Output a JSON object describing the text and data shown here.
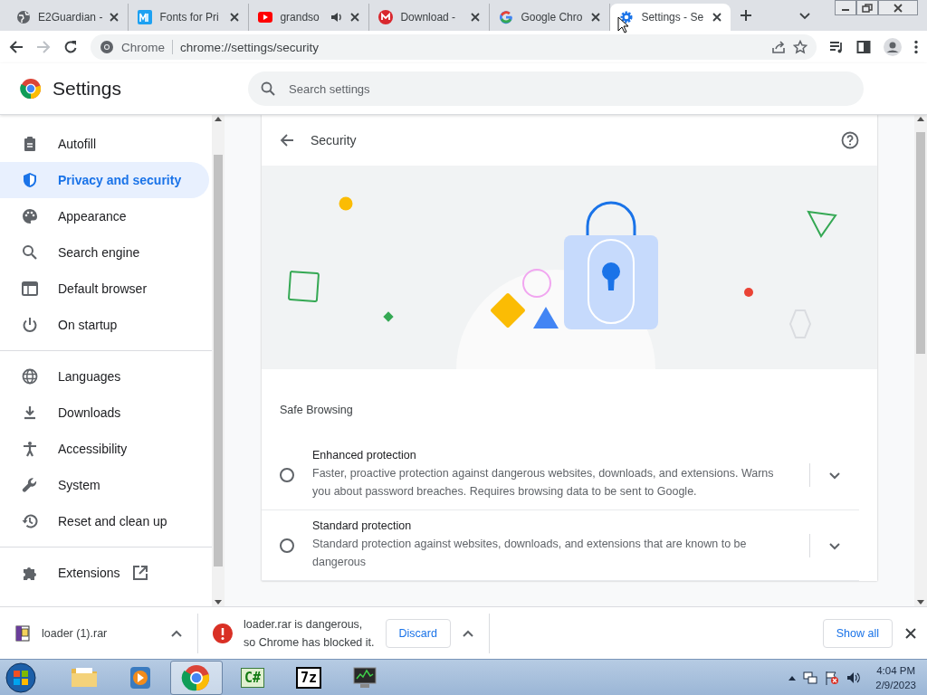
{
  "tabs": [
    {
      "title": "E2Guardian -",
      "kind": "globe",
      "audio": false,
      "selected": false
    },
    {
      "title": "Fonts for Pri",
      "kind": "fonts",
      "audio": false,
      "selected": false
    },
    {
      "title": "grandso",
      "kind": "video",
      "audio": true,
      "selected": false
    },
    {
      "title": "Download - ",
      "kind": "mega",
      "audio": false,
      "selected": false
    },
    {
      "title": "Google Chro",
      "kind": "google",
      "audio": false,
      "selected": false
    },
    {
      "title": "Settings - Se",
      "kind": "gear",
      "audio": false,
      "selected": true
    }
  ],
  "address_bar": {
    "site": "Chrome",
    "url": "chrome://settings/security"
  },
  "header": {
    "title": "Settings",
    "search_placeholder": "Search settings"
  },
  "sidebar": {
    "items": [
      {
        "label": "Autofill",
        "kind": "clipboard",
        "selected": false
      },
      {
        "label": "Privacy and security",
        "kind": "shield",
        "selected": true
      },
      {
        "label": "Appearance",
        "kind": "palette",
        "selected": false
      },
      {
        "label": "Search engine",
        "kind": "search",
        "selected": false
      },
      {
        "label": "Default browser",
        "kind": "browser",
        "selected": false
      },
      {
        "label": "On startup",
        "kind": "power",
        "selected": false
      },
      {
        "label": "Languages",
        "kind": "globe",
        "selected": false
      },
      {
        "label": "Downloads",
        "kind": "download",
        "selected": false
      },
      {
        "label": "Accessibility",
        "kind": "person",
        "selected": false
      },
      {
        "label": "System",
        "kind": "wrench",
        "selected": false
      },
      {
        "label": "Reset and clean up",
        "kind": "restore",
        "selected": false
      },
      {
        "label": "Extensions",
        "kind": "puzzle",
        "selected": false,
        "external": true
      }
    ]
  },
  "page": {
    "title": "Security",
    "section": "Safe Browsing",
    "options": [
      {
        "title": "Enhanced protection",
        "description": "Faster, proactive protection against dangerous websites, downloads, and extensions. Warns you about password breaches. Requires browsing data to be sent to Google.",
        "selected": false,
        "expanded": false
      },
      {
        "title": "Standard protection",
        "description": "Standard protection against websites, downloads, and extensions that are known to be dangerous",
        "selected": false,
        "expanded": false
      }
    ]
  },
  "download_bar": {
    "items": [
      {
        "kind": "file",
        "name": "loader (1).rar"
      },
      {
        "kind": "blocked",
        "lines": [
          "loader.rar is dangerous,",
          "so Chrome has blocked it."
        ],
        "action": "Discard"
      }
    ],
    "show_all": "Show all"
  },
  "taskbar": {
    "apps": [
      {
        "kind": "explorer",
        "selected": false
      },
      {
        "kind": "media",
        "selected": false
      },
      {
        "kind": "chrome",
        "selected": true
      },
      {
        "kind": "csharp",
        "glyph": "C#",
        "selected": false
      },
      {
        "kind": "sevenzip",
        "glyph": "7z",
        "selected": false
      },
      {
        "kind": "monitor",
        "selected": false
      }
    ],
    "time": "4:04 PM",
    "date": "2/9/2023"
  }
}
